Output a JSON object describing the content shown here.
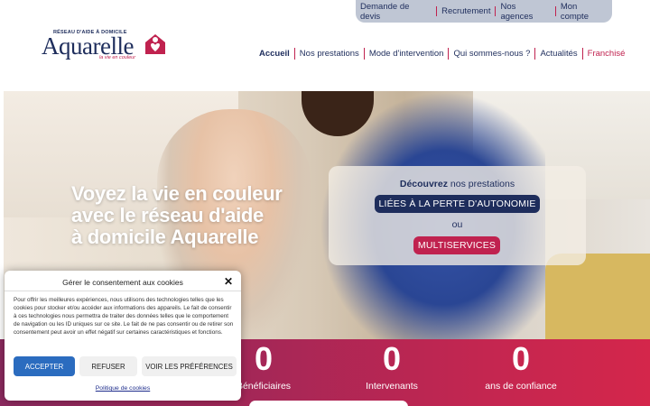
{
  "utility_nav": {
    "items": [
      {
        "label": "Demande de devis"
      },
      {
        "label": "Recrutement"
      },
      {
        "label": "Nos agences"
      },
      {
        "label": "Mon compte"
      }
    ]
  },
  "logo": {
    "tagline": "RÉSEAU D'AIDE À DOMICILE",
    "brand": "Aquarelle",
    "slogan": "la vie en couleur",
    "mark_icon": "house-heart-icon"
  },
  "main_nav": {
    "items": [
      {
        "label": "Accueil",
        "active": true
      },
      {
        "label": "Nos prestations"
      },
      {
        "label": "Mode d'intervention"
      },
      {
        "label": "Qui sommes-nous ?"
      },
      {
        "label": "Actualités"
      },
      {
        "label": "Franchisé"
      }
    ]
  },
  "hero": {
    "title_line1": "Voyez la vie en couleur",
    "title_line2": "avec le réseau d'aide",
    "title_line3": "à domicile Aquarelle",
    "panel": {
      "intro_bold": "Découvrez",
      "intro_rest": " nos prestations",
      "button_primary": "LIÉES À LA PERTE D'AUTONOMIE",
      "or": "ou",
      "button_secondary": "MULTISERVICES"
    }
  },
  "stats": [
    {
      "value": "0",
      "label": "Bénéficiaires"
    },
    {
      "value": "0",
      "label": "Intervenants"
    },
    {
      "value": "0",
      "label": "ans de confiance"
    }
  ],
  "cookie_dialog": {
    "title": "Gérer le consentement aux cookies",
    "close_icon": "close-icon",
    "body": "Pour offrir les meilleures expériences, nous utilisons des technologies telles que les cookies pour stocker et/ou accéder aux informations des appareils. Le fait de consentir à ces technologies nous permettra de traiter des données telles que le comportement de navigation ou les ID uniques sur ce site. Le fait de ne pas consentir ou de retirer son consentement peut avoir un effet négatif sur certaines caractéristiques et fonctions.",
    "accept": "ACCEPTER",
    "refuse": "REFUSER",
    "preferences": "VOIR LES PRÉFÉRENCES",
    "policy_link": "Politique de cookies"
  },
  "colors": {
    "navy": "#1e2d5c",
    "accent": "#c0224f",
    "accept_blue": "#2b6cbf"
  }
}
